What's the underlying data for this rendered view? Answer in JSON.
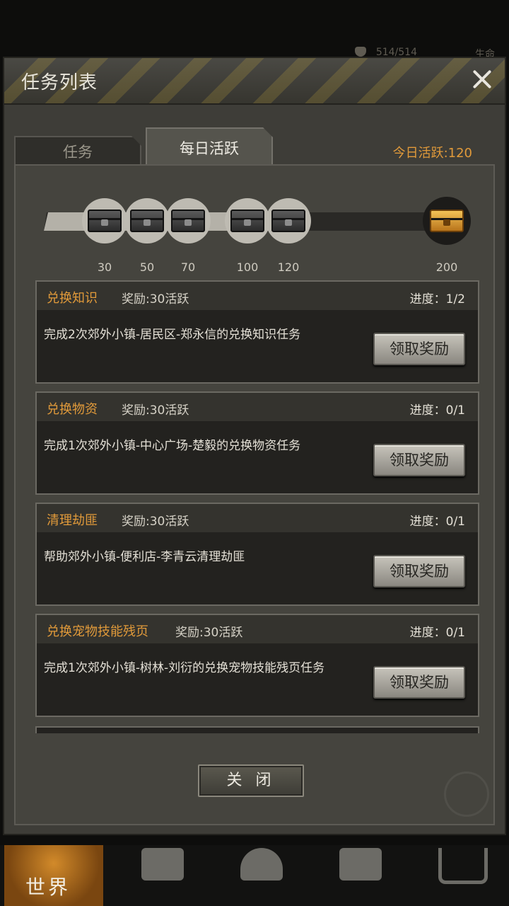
{
  "status": {
    "hp_text": "514/514",
    "right_text": "生命"
  },
  "dialog": {
    "title": "任务列表",
    "tabs": [
      {
        "label": "任务"
      },
      {
        "label": "每日活跃"
      }
    ],
    "today_active": "今日活跃:120",
    "milestones": [
      {
        "label": "30",
        "state": "reached"
      },
      {
        "label": "50",
        "state": "reached"
      },
      {
        "label": "70",
        "state": "reached"
      },
      {
        "label": "100",
        "state": "reached"
      },
      {
        "label": "120",
        "state": "reached"
      },
      {
        "label": "200",
        "state": "locked"
      }
    ],
    "active_progress_fraction": 0.6,
    "tasks": [
      {
        "name": "兑换知识",
        "reward": "奖励:30活跃",
        "progress": "进度：1/2",
        "desc": "完成2次郊外小镇-居民区-郑永信的兑换知识任务",
        "button": "领取奖励"
      },
      {
        "name": "兑换物资",
        "reward": "奖励:30活跃",
        "progress": "进度：0/1",
        "desc": "完成1次郊外小镇-中心广场-楚毅的兑换物资任务",
        "button": "领取奖励"
      },
      {
        "name": "清理劫匪",
        "reward": "奖励:30活跃",
        "progress": "进度：0/1",
        "desc": "帮助郊外小镇-便利店-李青云清理劫匪",
        "button": "领取奖励"
      },
      {
        "name": "兑换宠物技能残页",
        "reward": "奖励:30活跃",
        "progress": "进度：0/1",
        "desc": "完成1次郊外小镇-树林-刘衍的兑换宠物技能残页任务",
        "button": "领取奖励"
      }
    ],
    "close_label": "关 闭"
  },
  "bottom_nav": {
    "world_label": "世界"
  },
  "colors": {
    "accent": "#e19a3a",
    "panel": "#45443e",
    "card": "#23221f"
  }
}
